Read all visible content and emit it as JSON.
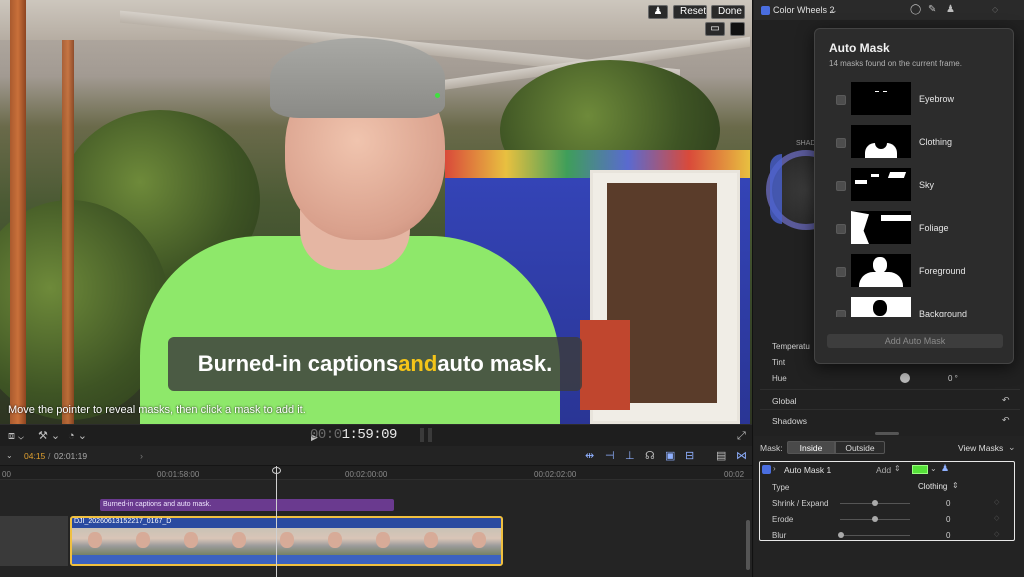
{
  "viewer": {
    "top_buttons": {
      "person_icon": "person-mask-icon",
      "reset_label": "Reset",
      "done_label": "Done"
    },
    "caption": {
      "before": "Burned-in captions ",
      "highlight": "and",
      "after": " auto mask."
    },
    "hint": "Move the pointer to reveal masks, then click a mask to add it.",
    "timecode": {
      "dim": "00:0",
      "bright": "1:59:09"
    }
  },
  "timeline": {
    "position": "04:15",
    "duration": "02:01:19",
    "ruler_labels": [
      "00",
      "00:01:58:00",
      "00:02:00:00",
      "00:02:02:00",
      "00:02"
    ],
    "title_clip": "Burned-in captions and auto mask.",
    "video_clip": "DJI_20260613152217_0167_D"
  },
  "inspector": {
    "effect_name": "Color Wheels 2",
    "shadows_wheel_label": "SHAD",
    "params": [
      {
        "label": "Temperatu"
      },
      {
        "label": "Tint"
      },
      {
        "label": "Hue",
        "value": "0 °"
      }
    ],
    "sections": [
      "Global",
      "Shadows"
    ],
    "mask_label": "Mask:",
    "mask_tabs": [
      "Inside",
      "Outside"
    ],
    "view_masks": "View Masks",
    "auto_mask": {
      "name": "Auto Mask 1",
      "add_label": "Add",
      "rows": [
        {
          "label": "Type",
          "value": "Clothing"
        },
        {
          "label": "Shrink / Expand",
          "value": "0"
        },
        {
          "label": "Erode",
          "value": "0"
        },
        {
          "label": "Blur",
          "value": "0"
        }
      ]
    }
  },
  "popover": {
    "title": "Auto Mask",
    "subtitle": "14 masks found on the current frame.",
    "masks": [
      "Eyebrow",
      "Clothing",
      "Sky",
      "Foliage",
      "Foreground",
      "Background"
    ],
    "add_button": "Add Auto Mask"
  },
  "colors": {
    "accent": "#4a6ee0",
    "shirt": "#8ee86a",
    "highlight": "#f5c518",
    "clip_border": "#f0c040",
    "title_clip": "#6a3a8f"
  }
}
